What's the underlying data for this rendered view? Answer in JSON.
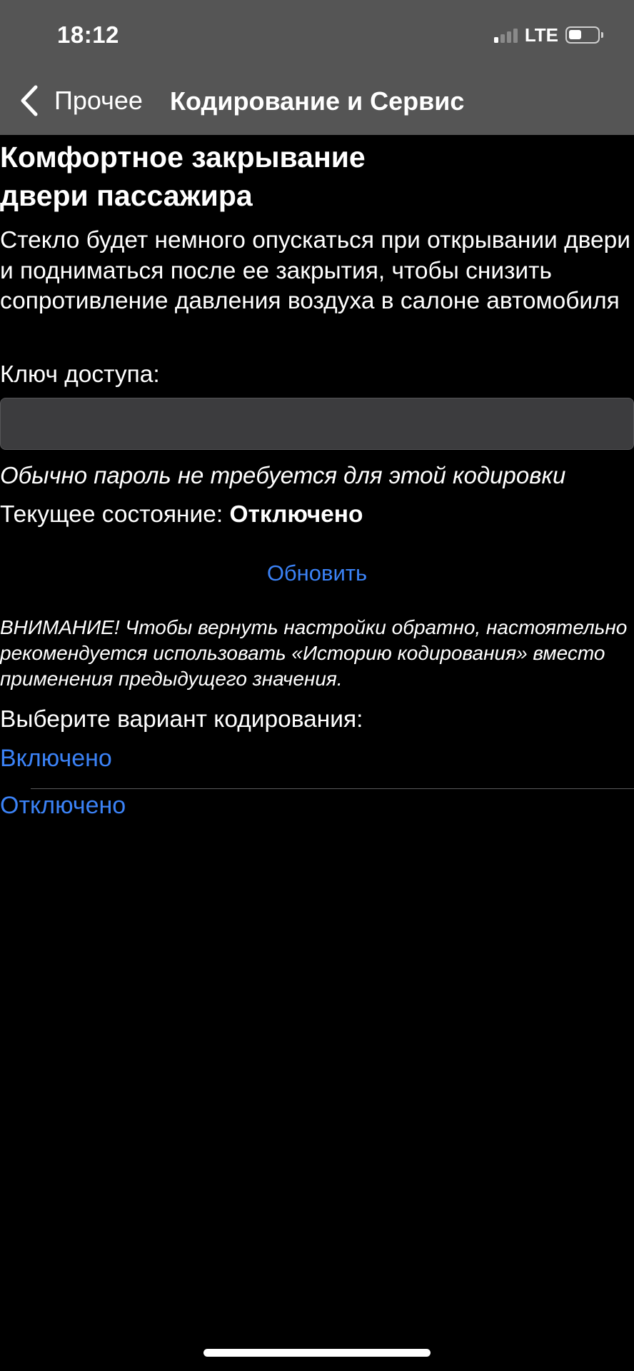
{
  "status_bar": {
    "time": "18:12",
    "network": "LTE",
    "signal_bars_active": 1,
    "signal_bars_total": 4,
    "battery_level": 0.45
  },
  "nav": {
    "back_label": "Прочее",
    "title": "Кодирование и Сервис",
    "back_icon": "chevron-left-icon"
  },
  "content": {
    "title_line1": "Комфортное закрывание",
    "title_line2": "двери пассажира",
    "description": "Стекло будет немного опускаться при открывании двери и подниматься после ее закрытия, чтобы снизить сопротивление давления воздуха в салоне автомобиля",
    "key_label": "Ключ доступа:",
    "key_value": "",
    "password_hint": "Обычно пароль не требуется для этой кодировки",
    "state_label": "Текущее состояние: ",
    "state_value": "Отключено",
    "refresh_label": "Обновить",
    "warning": "ВНИМАНИЕ! Чтобы вернуть настройки обратно, настоятельно рекомендуется использовать «Историю кодирования» вместо применения предыдущего значения.",
    "choose_label": "Выберите вариант кодирования:",
    "options": [
      {
        "label": "Включено"
      },
      {
        "label": "Отключено"
      }
    ]
  },
  "colors": {
    "background": "#000000",
    "nav_background": "#555555",
    "accent": "#3b82f6",
    "input_background": "#3c3c3e"
  }
}
